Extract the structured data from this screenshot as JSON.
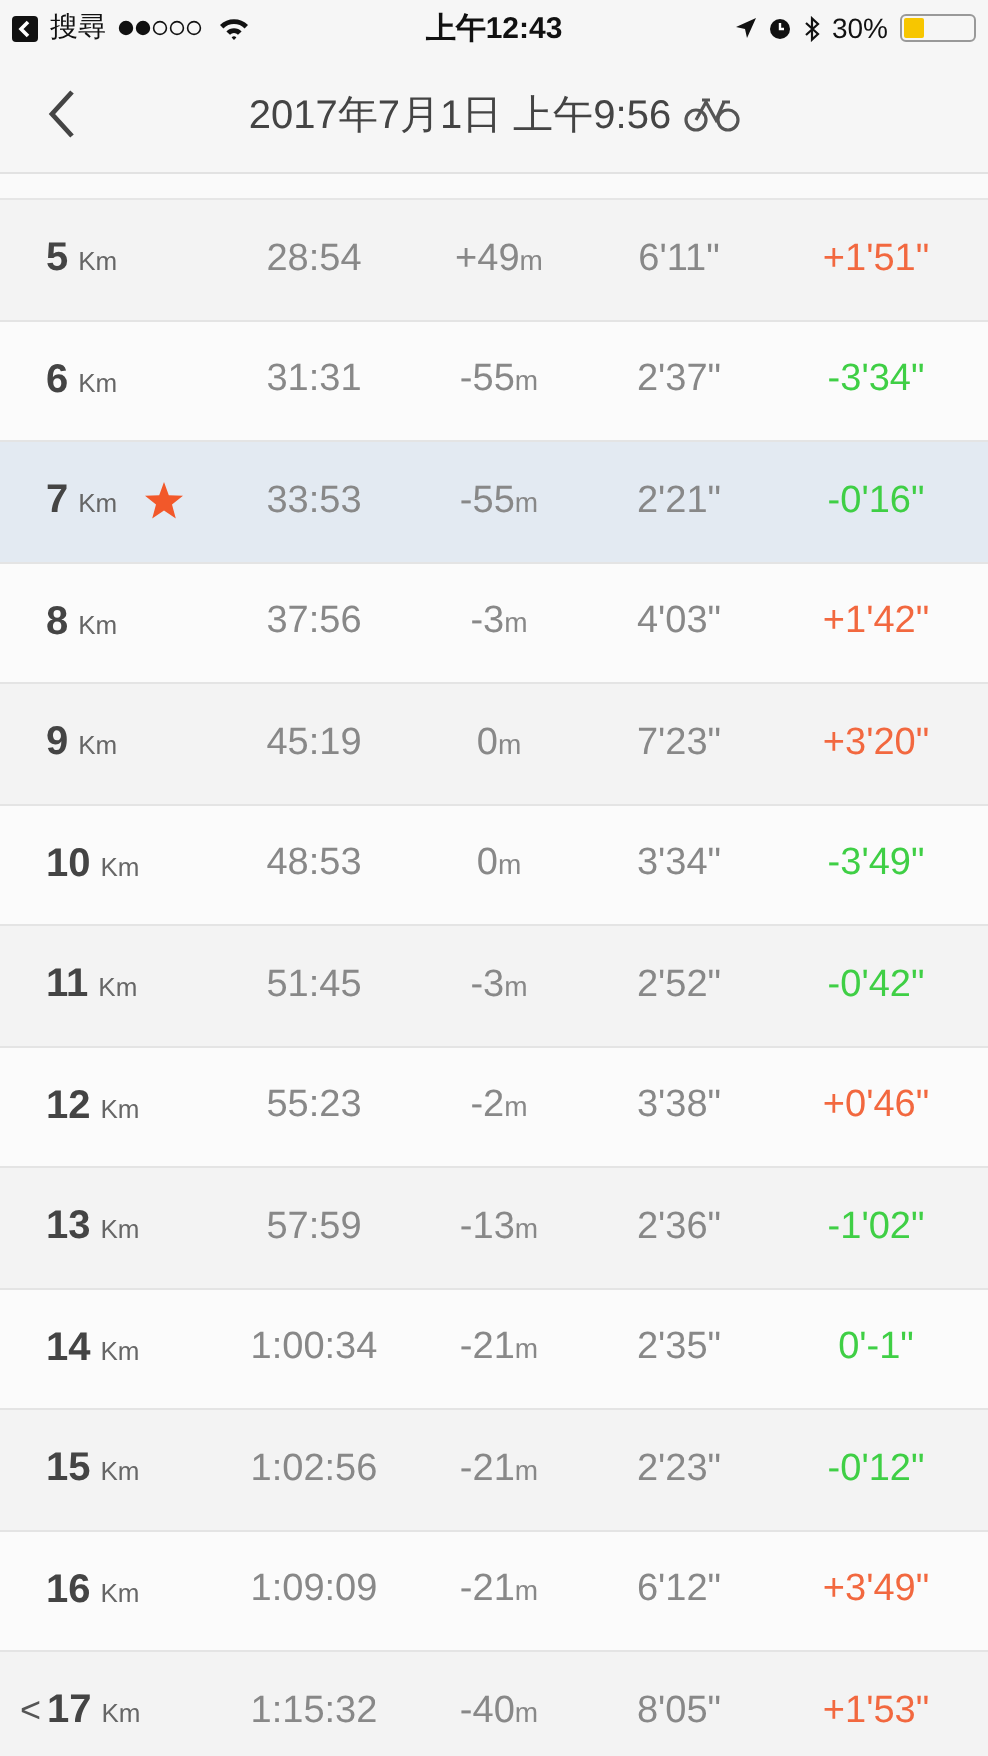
{
  "status_bar": {
    "back_app": "搜尋",
    "time": "上午12:43",
    "battery_text": "30%",
    "battery": {
      "level": 0.3
    }
  },
  "header": {
    "title": "2017年7月1日 上午9:56"
  },
  "rows": [
    {
      "km": "5",
      "km_unit": "Km",
      "starred": false,
      "selected": false,
      "time": "28:54",
      "elevation": "+49",
      "elevation_unit": "m",
      "pace": "6'11\"",
      "diff": "+1'51\"",
      "color": "#f2683f"
    },
    {
      "km": "6",
      "km_unit": "Km",
      "starred": false,
      "selected": false,
      "time": "31:31",
      "elevation": "-55",
      "elevation_unit": "m",
      "pace": "2'37\"",
      "diff": "-3'34\"",
      "color": "#3fcf45"
    },
    {
      "km": "7",
      "km_unit": "Km",
      "starred": true,
      "selected": true,
      "time": "33:53",
      "elevation": "-55",
      "elevation_unit": "m",
      "pace": "2'21\"",
      "diff": "-0'16\"",
      "color": "#3fcf45"
    },
    {
      "km": "8",
      "km_unit": "Km",
      "starred": false,
      "selected": false,
      "time": "37:56",
      "elevation": "-3",
      "elevation_unit": "m",
      "pace": "4'03\"",
      "diff": "+1'42\"",
      "color": "#f2683f"
    },
    {
      "km": "9",
      "km_unit": "Km",
      "starred": false,
      "selected": false,
      "time": "45:19",
      "elevation": "0",
      "elevation_unit": "m",
      "pace": "7'23\"",
      "diff": "+3'20\"",
      "color": "#f2683f"
    },
    {
      "km": "10",
      "km_unit": "Km",
      "starred": false,
      "selected": false,
      "time": "48:53",
      "elevation": "0",
      "elevation_unit": "m",
      "pace": "3'34\"",
      "diff": "-3'49\"",
      "color": "#3fcf45"
    },
    {
      "km": "11",
      "km_unit": "Km",
      "starred": false,
      "selected": false,
      "time": "51:45",
      "elevation": "-3",
      "elevation_unit": "m",
      "pace": "2'52\"",
      "diff": "-0'42\"",
      "color": "#3fcf45"
    },
    {
      "km": "12",
      "km_unit": "Km",
      "starred": false,
      "selected": false,
      "time": "55:23",
      "elevation": "-2",
      "elevation_unit": "m",
      "pace": "3'38\"",
      "diff": "+0'46\"",
      "color": "#f2683f"
    },
    {
      "km": "13",
      "km_unit": "Km",
      "starred": false,
      "selected": false,
      "time": "57:59",
      "elevation": "-13",
      "elevation_unit": "m",
      "pace": "2'36\"",
      "diff": "-1'02\"",
      "color": "#3fcf45"
    },
    {
      "km": "14",
      "km_unit": "Km",
      "starred": false,
      "selected": false,
      "time": "1:00:34",
      "elevation": "-21",
      "elevation_unit": "m",
      "pace": "2'35\"",
      "diff": "0'-1\"",
      "color": "#3fcf45"
    },
    {
      "km": "15",
      "km_unit": "Km",
      "starred": false,
      "selected": false,
      "time": "1:02:56",
      "elevation": "-21",
      "elevation_unit": "m",
      "pace": "2'23\"",
      "diff": "-0'12\"",
      "color": "#3fcf45"
    },
    {
      "km": "16",
      "km_unit": "Km",
      "starred": false,
      "selected": false,
      "time": "1:09:09",
      "elevation": "-21",
      "elevation_unit": "m",
      "pace": "6'12\"",
      "diff": "+3'49\"",
      "color": "#f2683f"
    },
    {
      "prefix": "<",
      "km": "17",
      "km_unit": "Km",
      "starred": false,
      "selected": false,
      "time": "1:15:32",
      "elevation": "-40",
      "elevation_unit": "m",
      "pace": "8'05\"",
      "diff": "+1'53\"",
      "color": "#f2683f"
    }
  ]
}
